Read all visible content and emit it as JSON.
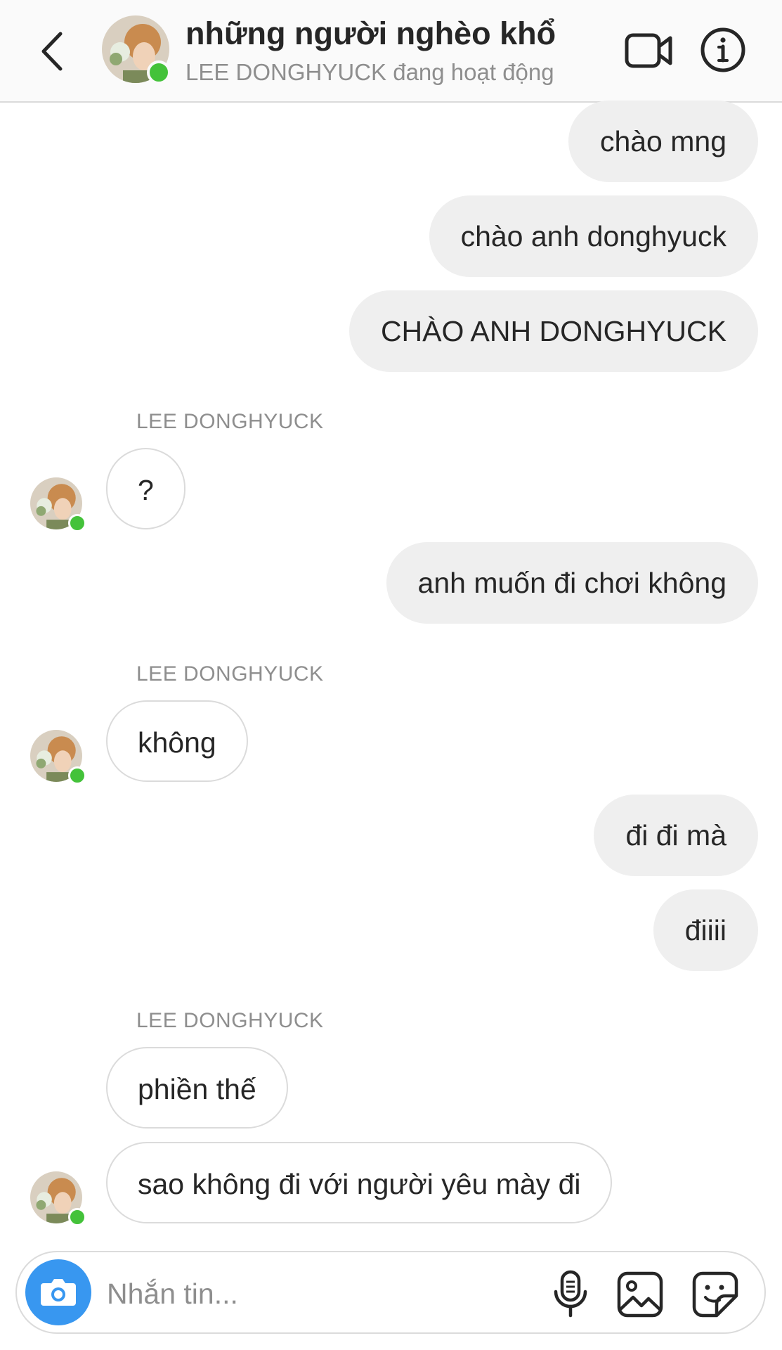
{
  "header": {
    "title": "những người nghèo khổ",
    "status": "LEE DONGHYUCK đang hoạt động"
  },
  "icons": {
    "back": "chevron-left-icon",
    "video": "video-camera-icon",
    "info": "info-icon",
    "camera": "camera-icon",
    "mic": "microphone-icon",
    "gallery": "image-gallery-icon",
    "sticker": "sticker-icon"
  },
  "colors": {
    "online": "#44c23a",
    "camera_button": "#3897f0",
    "outgoing_bubble": "#efefef",
    "incoming_border": "#dbdbdb",
    "secondary_text": "#8e8e8e"
  },
  "messages": [
    {
      "direction": "out",
      "text": "chào mng"
    },
    {
      "direction": "out",
      "text": "chào anh donghyuck"
    },
    {
      "direction": "out",
      "text": "CHÀO ANH DONGHYUCK"
    },
    {
      "direction": "in",
      "sender": "LEE DONGHYUCK",
      "text": "?"
    },
    {
      "direction": "out",
      "text": "anh muốn đi chơi không"
    },
    {
      "direction": "in",
      "sender": "LEE DONGHYUCK",
      "text": "không"
    },
    {
      "direction": "out",
      "text": "đi đi mà"
    },
    {
      "direction": "out",
      "text": "điiii"
    },
    {
      "direction": "in",
      "sender": "LEE DONGHYUCK",
      "text": "phiền thế"
    },
    {
      "direction": "in",
      "text": "sao không đi với người yêu mày đi"
    }
  ],
  "composer": {
    "placeholder": "Nhắn tin..."
  }
}
